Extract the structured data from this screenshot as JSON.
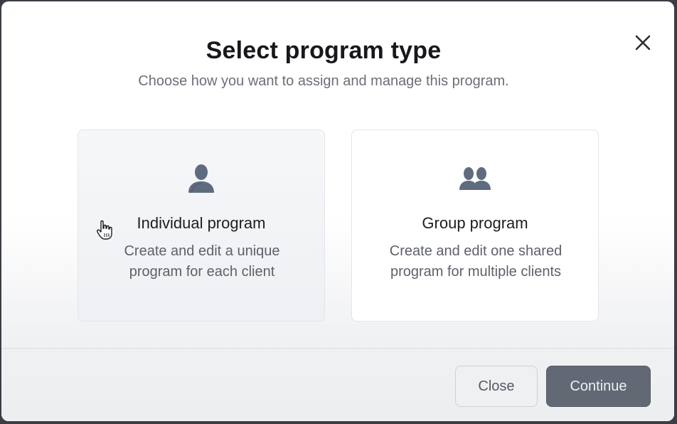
{
  "dialog": {
    "title": "Select program type",
    "subtitle": "Choose how you want to assign and manage this program.",
    "close_icon": "close-icon"
  },
  "options": [
    {
      "icon": "person-icon",
      "title": "Individual program",
      "description": "Create and edit a unique program for each client"
    },
    {
      "icon": "group-icon",
      "title": "Group program",
      "description": "Create and edit one shared program for multiple clients"
    }
  ],
  "footer": {
    "close_label": "Close",
    "continue_label": "Continue"
  },
  "colors": {
    "icon": "#5f6c80",
    "continue_button": "#626975",
    "title_text": "#16181c"
  }
}
